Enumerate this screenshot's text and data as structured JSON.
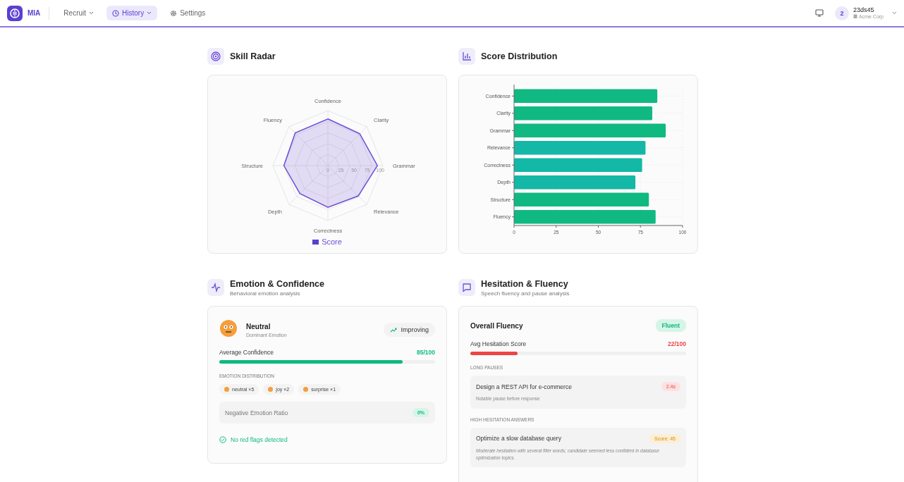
{
  "nav": {
    "logo": "MIA",
    "items": [
      {
        "label": "Recruit",
        "selected": false,
        "dropdown": true
      },
      {
        "label": "History",
        "selected": true,
        "dropdown": true
      },
      {
        "label": "Settings",
        "selected": false,
        "dropdown": false
      }
    ],
    "user": {
      "badge": "2",
      "name": "23ds45",
      "org": "Acme Corp"
    }
  },
  "radar": {
    "title": "Skill Radar",
    "legend": "Score",
    "ticks": [
      "0",
      "25",
      "50",
      "75",
      "100"
    ],
    "axes": [
      "Confidence",
      "Clarity",
      "Grammar",
      "Relevance",
      "Correctness",
      "Depth",
      "Structure",
      "Fluency"
    ]
  },
  "distribution": {
    "title": "Score Distribution",
    "chart_data": {
      "type": "bar",
      "orientation": "horizontal",
      "categories": [
        "Confidence",
        "Clarity",
        "Grammar",
        "Relevance",
        "Correctness",
        "Depth",
        "Structure",
        "Fluency"
      ],
      "series": [
        {
          "color": "#10b981",
          "values": [
            85,
            82,
            90,
            null,
            null,
            null,
            80,
            84
          ]
        },
        {
          "color": "#14b8a6",
          "values": [
            null,
            null,
            null,
            78,
            76,
            72,
            null,
            null
          ]
        }
      ],
      "grid": true,
      "xlim": [
        0,
        100
      ],
      "xticks": [
        0,
        25,
        50,
        75,
        100
      ]
    }
  },
  "emotion": {
    "title": "Emotion & Confidence",
    "subtitle": "Behavioral emotion analysis",
    "dominant": "Neutral",
    "dominant_label": "Dominant Emotion",
    "trend": "Improving",
    "confidence_label": "Average Confidence",
    "confidence_value": "85/100",
    "level": 0.85,
    "distribution_label": "EMOTION DISTRIBUTION",
    "chips": [
      "neutral ×5",
      "joy ×2",
      "surprise ×1"
    ],
    "ratio_label": "Negative Emotion Ratio",
    "ratio_value": "0%",
    "flags": "No red flags detected"
  },
  "hesitation": {
    "title": "Hesitation & Fluency",
    "subtitle": "Speech fluency and pause analysis",
    "overall_label": "Overall Fluency",
    "overall_value": "Fluent",
    "score_label": "Avg Hesitation Score",
    "score_value": "22/100",
    "level": 0.22,
    "pauses_label": "LONG PAUSES",
    "pauses": [
      {
        "question": "Design a REST API for e-commerce",
        "note": "Notable pause before response",
        "badge": "2.4s",
        "kind": "pause"
      }
    ],
    "answers_label": "HIGH HESITATION ANSWERS",
    "answers": [
      {
        "question": "Optimize a slow database query",
        "note": "Moderate hesitation with several filler words; candidate seemed less confident in database optimization topics.",
        "badge": "Score: 45",
        "kind": "score"
      }
    ]
  }
}
